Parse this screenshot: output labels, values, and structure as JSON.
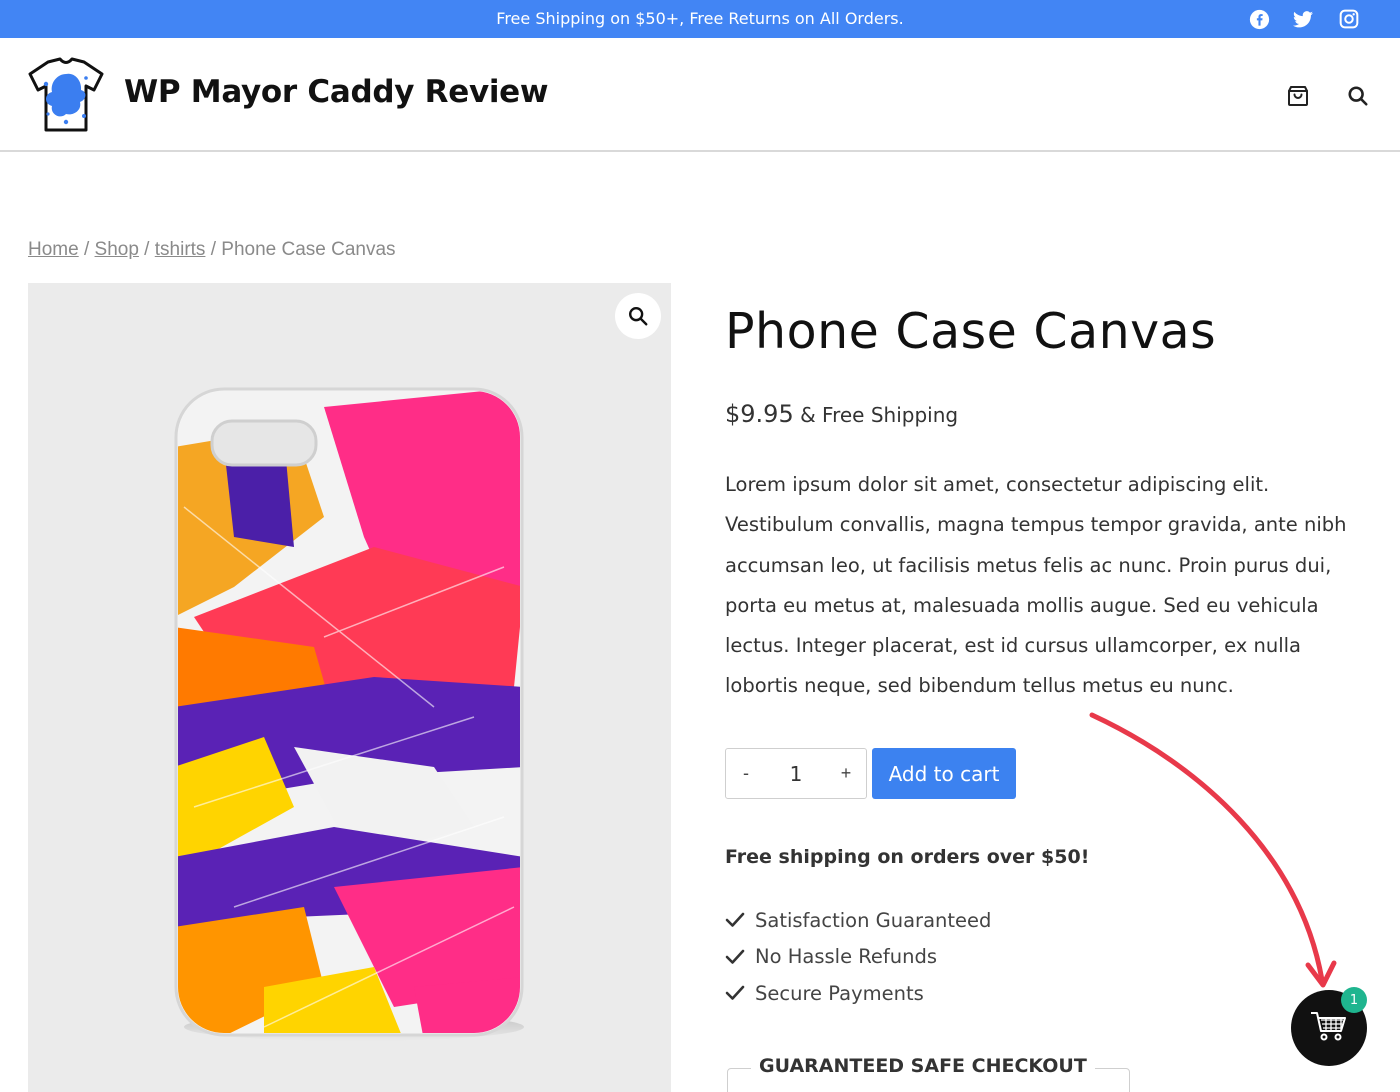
{
  "topbar": {
    "message": "Free Shipping on $50+, Free Returns on All Orders.",
    "social": [
      "facebook-icon",
      "twitter-icon",
      "instagram-icon"
    ]
  },
  "header": {
    "site_title": "WP Mayor Caddy Review",
    "icons": [
      "shopping-bag-icon",
      "search-icon"
    ]
  },
  "breadcrumb": {
    "home": "Home",
    "sep1": " / ",
    "shop": "Shop",
    "sep2": " / ",
    "category": "tshirts",
    "sep3": " / ",
    "current": "Phone Case Canvas"
  },
  "product": {
    "title": "Phone Case Canvas",
    "price": "$9.95",
    "price_note": " & Free Shipping",
    "description": "Lorem ipsum dolor sit amet, consectetur adipiscing elit. Vestibulum convallis, magna tempus tempor gravida, ante nibh accumsan leo, ut facilisis metus felis ac nunc. Proin purus dui, porta eu metus at, malesuada mollis augue. Sed eu vehicula lectus. Integer placerat, est id cursus ullamcorper, ex nulla lobortis neque, sed bibendum tellus metus eu nunc.",
    "quantity": "1",
    "qty_minus": "-",
    "qty_plus": "+",
    "add_to_cart": "Add to cart",
    "shipping_heading": "Free shipping on orders over $50!",
    "features": [
      "Satisfaction Guaranteed",
      "No Hassle Refunds",
      "Secure Payments"
    ],
    "checkout_label": "GUARANTEED SAFE CHECKOUT"
  },
  "floating_cart": {
    "badge_count": "1",
    "icon": "cart-icon"
  },
  "colors": {
    "topbar": "#4285f4",
    "button": "#3c82f0",
    "badge": "#1fb58f",
    "annotation_arrow": "#e8394a"
  }
}
